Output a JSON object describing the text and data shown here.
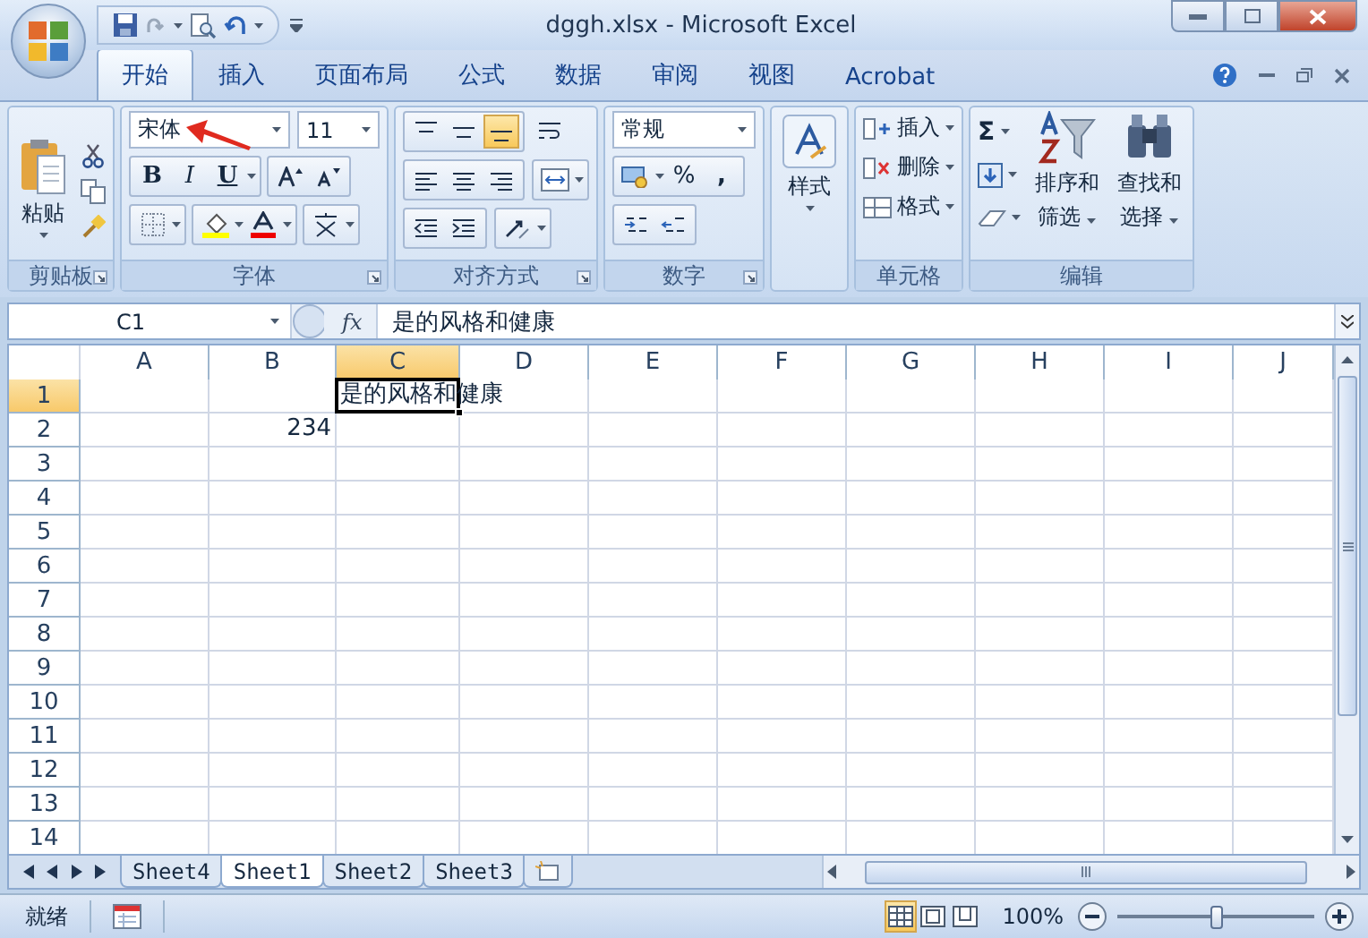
{
  "window": {
    "title": "dggh.xlsx - Microsoft Excel"
  },
  "tabs": [
    {
      "label": "开始",
      "selected": true
    },
    {
      "label": "插入",
      "selected": false
    },
    {
      "label": "页面布局",
      "selected": false
    },
    {
      "label": "公式",
      "selected": false
    },
    {
      "label": "数据",
      "selected": false
    },
    {
      "label": "审阅",
      "selected": false
    },
    {
      "label": "视图",
      "selected": false
    },
    {
      "label": "Acrobat",
      "selected": false
    }
  ],
  "ribbon": {
    "groups": [
      {
        "kind": "clipboard",
        "label": "剪贴板",
        "launcher": true,
        "paste": "粘贴"
      },
      {
        "kind": "font",
        "label": "字体",
        "launcher": true,
        "font_name": "宋体",
        "font_size": "11",
        "bold": "B",
        "italic": "I",
        "underline": "U"
      },
      {
        "kind": "alignment",
        "label": "对齐方式",
        "launcher": true,
        "vertical_align": [
          {
            "selected": false
          },
          {
            "selected": false
          },
          {
            "selected": true
          }
        ]
      },
      {
        "kind": "number",
        "label": "数字",
        "launcher": true,
        "format": "常规",
        "percent": "%",
        "comma": ","
      },
      {
        "kind": "styles",
        "button": "样式"
      },
      {
        "kind": "cells",
        "label": "单元格",
        "launcher": false,
        "items": [
          "插入",
          "删除",
          "格式"
        ]
      },
      {
        "kind": "editing",
        "label": "编辑",
        "launcher": false,
        "sum": "Σ",
        "sort": [
          "排序和",
          "筛选"
        ],
        "find": [
          "查找和",
          "选择"
        ]
      }
    ]
  },
  "formula_bar": {
    "name_box": "C1",
    "fx": "fx",
    "content": "是的风格和健康"
  },
  "columns": [
    {
      "label": "A",
      "selected": false
    },
    {
      "label": "B",
      "selected": false
    },
    {
      "label": "C",
      "selected": true
    },
    {
      "label": "D",
      "selected": false
    },
    {
      "label": "E",
      "selected": false
    },
    {
      "label": "F",
      "selected": false
    },
    {
      "label": "G",
      "selected": false
    },
    {
      "label": "H",
      "selected": false
    },
    {
      "label": "I",
      "selected": false
    },
    {
      "label": "J",
      "selected": false
    }
  ],
  "rows": [
    {
      "header": "1",
      "selected": true,
      "cells": [
        null,
        null,
        {
          "kind": "text",
          "text": "是的风格和健康",
          "selected": true
        }
      ]
    },
    {
      "header": "2",
      "selected": false,
      "cells": [
        null,
        {
          "kind": "number",
          "text": "234",
          "selected": false
        }
      ]
    },
    {
      "header": "3",
      "selected": false
    },
    {
      "header": "4",
      "selected": false
    },
    {
      "header": "5",
      "selected": false
    },
    {
      "header": "6",
      "selected": false
    },
    {
      "header": "7",
      "selected": false
    },
    {
      "header": "8",
      "selected": false
    },
    {
      "header": "9",
      "selected": false
    },
    {
      "header": "10",
      "selected": false
    },
    {
      "header": "11",
      "selected": false
    },
    {
      "header": "12",
      "selected": false
    },
    {
      "header": "13",
      "selected": false
    },
    {
      "header": "14",
      "selected": false
    }
  ],
  "sheets": [
    {
      "label": "Sheet4",
      "selected": false
    },
    {
      "label": "Sheet1",
      "selected": true
    },
    {
      "label": "Sheet2",
      "selected": false
    },
    {
      "label": "Sheet3",
      "selected": false
    }
  ],
  "status_bar": {
    "status": "就绪",
    "views": [
      {
        "selected": true
      },
      {
        "selected": false
      },
      {
        "selected": false
      }
    ],
    "zoom": "100%",
    "zoom_slider": {
      "level": 0.5
    }
  }
}
